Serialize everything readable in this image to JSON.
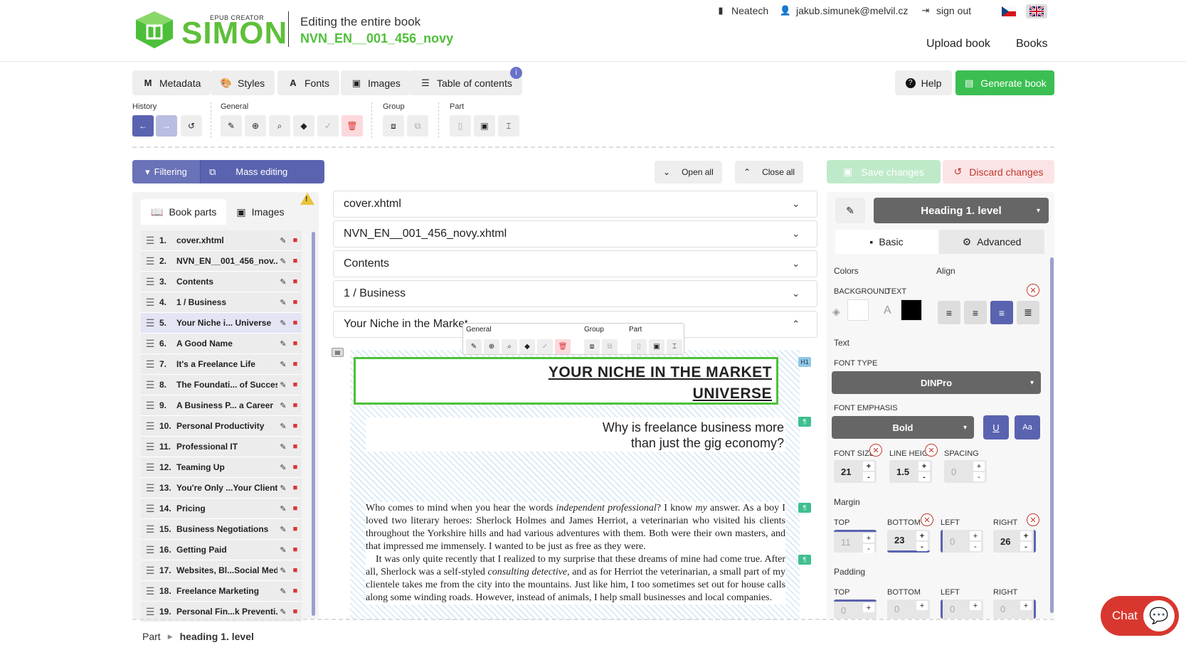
{
  "header": {
    "logo_small": "EPUB CREATOR",
    "logo_word": "SIMON",
    "edit_title": "Editing the entire book",
    "book_name": "NVN_EN__001_456_novy",
    "org": "Neatech",
    "user": "jakub.simunek@melvil.cz",
    "signout": "sign out",
    "nav": {
      "upload": "Upload book",
      "books": "Books"
    }
  },
  "tabs": {
    "metadata": "Metadata",
    "styles": "Styles",
    "fonts": "Fonts",
    "images": "Images",
    "toc": "Table of contents",
    "toc_badge": "i",
    "help": "Help",
    "generate": "Generate book"
  },
  "toolbar": {
    "history": "History",
    "general": "General",
    "group": "Group",
    "part": "Part"
  },
  "filterbar": {
    "filtering": "Filtering",
    "mass": "Mass editing"
  },
  "controls": {
    "open_all": "Open all",
    "close_all": "Close all",
    "save": "Save changes",
    "discard": "Discard changes"
  },
  "leftpanel": {
    "tab_parts": "Book parts",
    "tab_images": "Images",
    "warn": "!",
    "parts": [
      {
        "num": "1.",
        "title": "cover.xhtml"
      },
      {
        "num": "2.",
        "title": "NVN_EN__001_456_nov..."
      },
      {
        "num": "3.",
        "title": "Contents"
      },
      {
        "num": "4.",
        "title": "1 / Business"
      },
      {
        "num": "5.",
        "title": "Your Niche i... Universe"
      },
      {
        "num": "6.",
        "title": "A Good Name"
      },
      {
        "num": "7.",
        "title": "It's a Freelance Life"
      },
      {
        "num": "8.",
        "title": "The Foundati... of Success"
      },
      {
        "num": "9.",
        "title": "A Business P... a Career"
      },
      {
        "num": "10.",
        "title": "Personal Productivity"
      },
      {
        "num": "11.",
        "title": "Professional IT"
      },
      {
        "num": "12.",
        "title": "Teaming Up"
      },
      {
        "num": "13.",
        "title": "You're Only ...Your Clients"
      },
      {
        "num": "14.",
        "title": "Pricing"
      },
      {
        "num": "15.",
        "title": "Business Negotiations"
      },
      {
        "num": "16.",
        "title": "Getting Paid"
      },
      {
        "num": "17.",
        "title": "Websites, Bl...Social Media"
      },
      {
        "num": "18.",
        "title": "Freelance Marketing"
      },
      {
        "num": "19.",
        "title": "Personal Fin...k Preventi..."
      }
    ]
  },
  "accordion": [
    "cover.xhtml",
    "NVN_EN__001_456_novy.xhtml",
    "Contents",
    "1 / Business",
    "Your Niche in the Market"
  ],
  "editor": {
    "heading_l1": "YOUR NICHE IN THE MARKET",
    "heading_l2": "UNIVERSE",
    "h1_badge": "H1",
    "sub_l1": "Why is freelance business more",
    "sub_l2": "than just the gig economy?",
    "para_badge": "¶",
    "p1a": "Who comes to mind when you hear the words ",
    "p1b": "independent professional",
    "p1c": "? I know ",
    "p1d": "my",
    "p1e": " answer. As a boy I loved two literary heroes: Sherlock Holmes and James Herriot, a veterinarian who visited his clients throughout the Yorkshire hills and had various adventures with them. Both were their own masters, and that impressed me immensely. I wanted to be just as free as they were.",
    "p2a": "It was only quite recently that I realized to my surprise that these dreams of mine had come true. After all, Sherlock was a self-styled ",
    "p2b": "consulting detective",
    "p2c": ", and as for Herriot the veterinarian, a small part of my clientele takes me from the city into the mountains. Just like him, I too sometimes set out for house calls along some winding roads. However, instead of animals, I help small businesses and local companies."
  },
  "floating": {
    "general": "General",
    "group": "Group",
    "part": "Part"
  },
  "rightpanel": {
    "heading_select": "Heading 1. level",
    "tab_basic": "Basic",
    "tab_advanced": "Advanced",
    "colors": "Colors",
    "align": "Align",
    "background": "BACKGROUND",
    "text_label": "TEXT",
    "text_section": "Text",
    "font_type": "FONT TYPE",
    "font_value": "DINPro",
    "font_emphasis": "FONT EMPHASIS",
    "emphasis_value": "Bold",
    "underline": "U",
    "case": "Aa",
    "font_size": "FONT SIZE",
    "font_size_value": "21",
    "line_height": "LINE HEIGH",
    "line_height_value": "1.5",
    "spacing": "SPACING",
    "spacing_value": "0",
    "margin": "Margin",
    "padding": "Padding",
    "top": "TOP",
    "bottom": "BOTTOM",
    "left": "LEFT",
    "right": "RIGHT",
    "margin_top": "11",
    "margin_bottom": "23",
    "margin_left": "0",
    "margin_right": "26",
    "padding_top": "0",
    "padding_bottom": "0",
    "padding_left": "0",
    "padding_right": "0"
  },
  "footer": {
    "part": "Part",
    "current": "heading 1. level"
  },
  "chat": "Chat"
}
